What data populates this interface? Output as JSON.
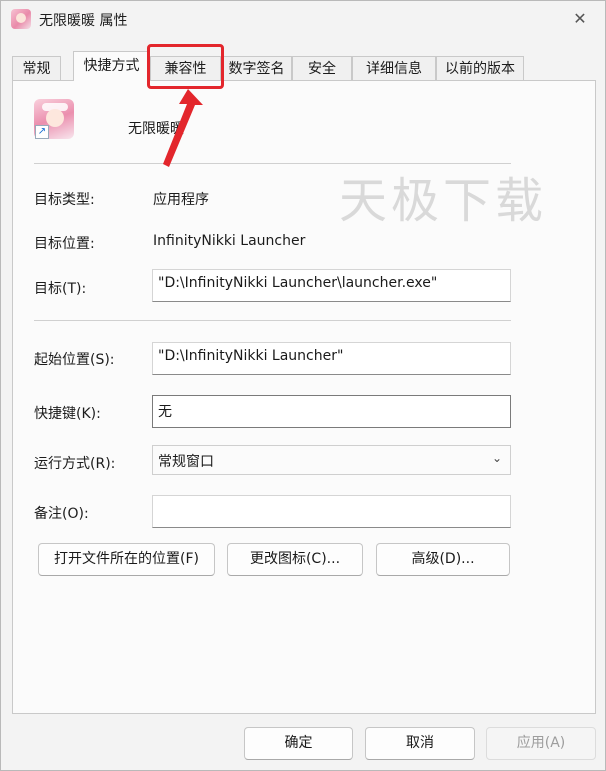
{
  "window": {
    "title": "无限暖暖 属性",
    "close_glyph": "✕"
  },
  "tabs": [
    {
      "label": "常规"
    },
    {
      "label": "快捷方式",
      "active": true
    },
    {
      "label": "兼容性",
      "highlighted": true
    },
    {
      "label": "数字签名"
    },
    {
      "label": "安全"
    },
    {
      "label": "详细信息"
    },
    {
      "label": "以前的版本"
    }
  ],
  "shortcut": {
    "app_name": "无限暖暖",
    "target_type_label": "目标类型:",
    "target_type_value": "应用程序",
    "target_location_label": "目标位置:",
    "target_location_value": "InfinityNikki Launcher",
    "target_label": "目标(T):",
    "target_value": "\"D:\\InfinityNikki Launcher\\launcher.exe\"",
    "start_in_label": "起始位置(S):",
    "start_in_value": "\"D:\\InfinityNikki Launcher\"",
    "hotkey_label": "快捷键(K):",
    "hotkey_value": "无",
    "run_label": "运行方式(R):",
    "run_value": "常规窗口",
    "comment_label": "备注(O):",
    "comment_value": ""
  },
  "actions": {
    "open_location": "打开文件所在的位置(F)",
    "change_icon": "更改图标(C)...",
    "advanced": "高级(D)..."
  },
  "footer": {
    "ok": "确定",
    "cancel": "取消",
    "apply": "应用(A)"
  },
  "watermark": "天极下载",
  "annotation_color": "#e3262c"
}
